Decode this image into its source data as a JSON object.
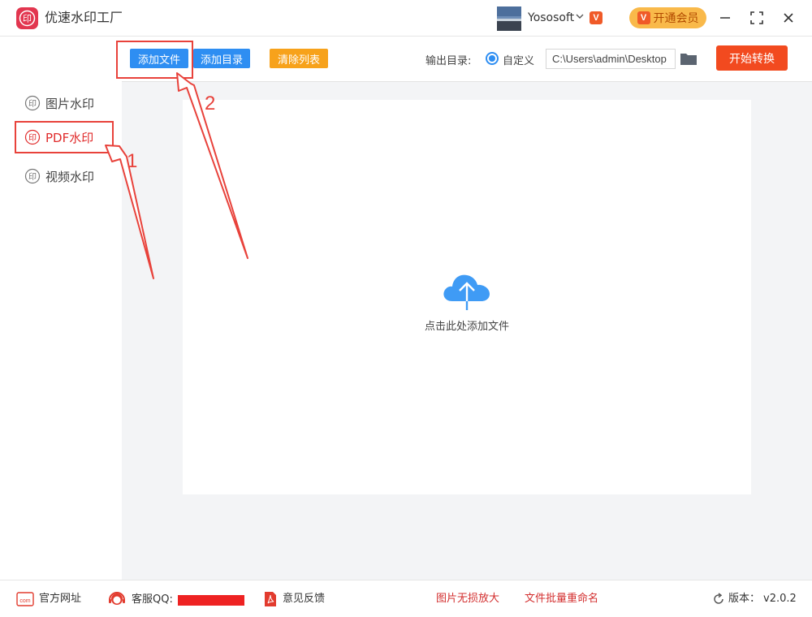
{
  "app": {
    "title": "优速水印工厂",
    "logo_glyph": "印",
    "username": "Yososoft",
    "vip_badge": "V",
    "vip_label": "开通会员"
  },
  "sidebar": {
    "items": [
      {
        "label": "图片水印",
        "active": false
      },
      {
        "label": "PDF水印",
        "active": true
      },
      {
        "label": "视频水印",
        "active": false
      }
    ],
    "icon_glyph": "印"
  },
  "toolbar": {
    "add_file_label": "添加文件",
    "add_folder_label": "添加目录",
    "clear_list_label": "清除列表",
    "output_dir_label": "输出目录:",
    "custom_label": "自定义",
    "output_path": "C:\\Users\\admin\\Desktop",
    "start_label": "开始转换"
  },
  "drop_zone": {
    "hint": "点击此处添加文件"
  },
  "footer": {
    "website_label": "官方网址",
    "website_icon_text": "com",
    "qq_label": "客服QQ:",
    "feedback_label": "意见反馈",
    "link_upscale": "图片无损放大",
    "link_rename": "文件批量重命名",
    "version_label": "版本：",
    "version_value": "v2.0.2"
  },
  "annotations": {
    "step1": "1",
    "step2": "2"
  },
  "colors": {
    "accent_blue": "#2e8ef2",
    "accent_orange": "#f7a21b",
    "start_red": "#f24a1f",
    "highlight_red": "#e8423b",
    "brand": "#e2364f"
  }
}
